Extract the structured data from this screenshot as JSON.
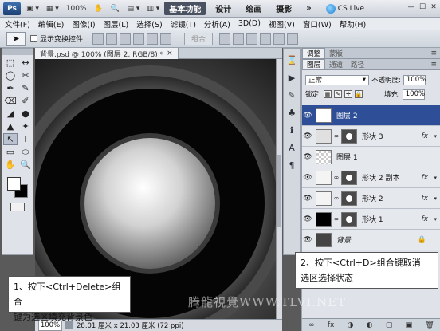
{
  "appbar": {
    "logo": "Ps",
    "items": [
      "▣ ▾",
      "▦ ▾",
      "100%",
      "✋",
      "🔍",
      "▤ ▾",
      "▥ ▾"
    ],
    "workspaces": [
      "基本功能",
      "设计",
      "绘画",
      "摄影",
      "»"
    ],
    "cslive": "CS Live",
    "window_buttons": [
      "—",
      "☐",
      "✕"
    ]
  },
  "menubar": [
    "文件(F)",
    "编辑(E)",
    "图像(I)",
    "图层(L)",
    "选择(S)",
    "滤镜(T)",
    "分析(A)",
    "3D(D)",
    "视图(V)",
    "窗口(W)",
    "帮助(H)"
  ],
  "options": {
    "show_transform_label": "显示变换控件",
    "combine_button": "组合"
  },
  "document": {
    "tab_title": "背景.psd @ 100% (图层 2, RGB/8) *",
    "tab_close": "×",
    "zoom": "100%",
    "status": "28.01 厘米 x 21.03 厘米 (72 ppi)"
  },
  "toolbox": {
    "tools": [
      "⬚",
      "↔",
      "◯",
      "✂",
      "✒",
      "✎",
      "⌫",
      "✐",
      "◢",
      "●",
      "▲",
      "✦",
      "↖",
      "T",
      "▭",
      "⬭",
      "✋",
      "🔍"
    ]
  },
  "panel": {
    "top_tabs": [
      "调整",
      "蒙版"
    ],
    "layer_tabs": [
      "图层",
      "通道",
      "路径"
    ],
    "blend_mode": "正常",
    "opacity_label": "不透明度:",
    "opacity_value": "100%",
    "lock_label": "锁定:",
    "fill_label": "填充:",
    "fill_value": "100%",
    "layers": [
      {
        "name": "图层 2",
        "selected": true,
        "fx": false,
        "mask": false
      },
      {
        "name": "形状 3",
        "selected": false,
        "fx": true,
        "mask": true
      },
      {
        "name": "图层 1",
        "selected": false,
        "fx": false,
        "mask": false
      },
      {
        "name": "形状 2 副本",
        "selected": false,
        "fx": true,
        "mask": true
      },
      {
        "name": "形状 2",
        "selected": false,
        "fx": true,
        "mask": true
      },
      {
        "name": "形状 1",
        "selected": false,
        "fx": true,
        "mask": true
      },
      {
        "name": "背景",
        "selected": false,
        "fx": false,
        "mask": false,
        "locked": true
      }
    ],
    "bottom_icons": [
      "∞",
      "fx",
      "◑",
      "◐",
      "▢",
      "▣",
      "🗑"
    ]
  },
  "notes": {
    "note1_line1": "1、按下<Ctrl+Delete>组合",
    "note1_line2": "键为选区填充背景色",
    "note2_line1": "2、按下<Ctrl+D>组合键取消",
    "note2_line2": "选区选择状态"
  },
  "watermark": "腾龍視覺WWW.TLVI.NET"
}
